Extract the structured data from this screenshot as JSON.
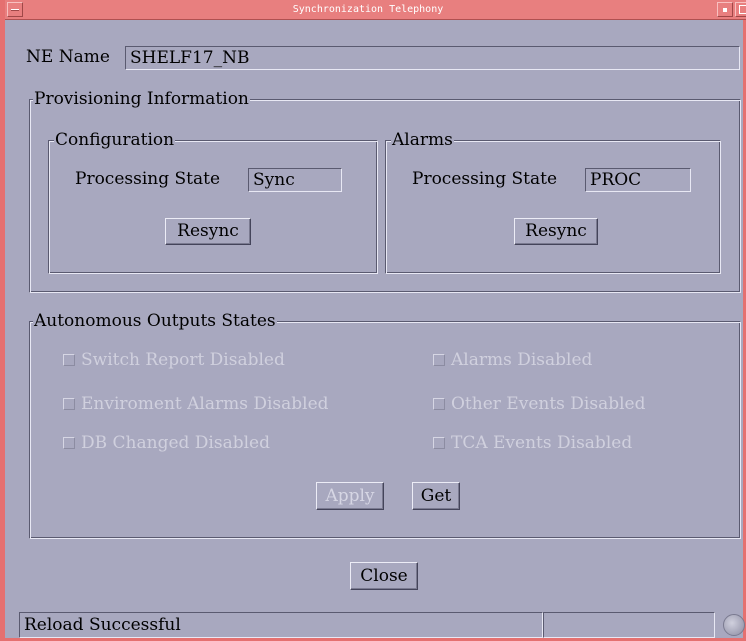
{
  "window": {
    "title": "Synchronization Telephony"
  },
  "ne": {
    "label": "NE Name",
    "value": "SHELF17_NB"
  },
  "provisioning": {
    "title": "Provisioning Information",
    "configuration": {
      "title": "Configuration",
      "state_label": "Processing State",
      "state_value": "Sync",
      "button": "Resync"
    },
    "alarms": {
      "title": "Alarms",
      "state_label": "Processing State",
      "state_value": "PROC",
      "button": "Resync"
    }
  },
  "autonomous": {
    "title": "Autonomous Outputs States",
    "checkboxes": [
      {
        "label": "Switch Report Disabled",
        "checked": false,
        "enabled": false
      },
      {
        "label": "Alarms Disabled",
        "checked": false,
        "enabled": false
      },
      {
        "label": "Enviroment Alarms Disabled",
        "checked": false,
        "enabled": false
      },
      {
        "label": "Other Events Disabled",
        "checked": false,
        "enabled": false
      },
      {
        "label": "DB Changed Disabled",
        "checked": false,
        "enabled": false
      },
      {
        "label": "TCA Events Disabled",
        "checked": false,
        "enabled": false
      }
    ],
    "apply_label": "Apply",
    "get_label": "Get"
  },
  "close_label": "Close",
  "status": {
    "message": "Reload Successful",
    "secondary": ""
  },
  "icons": {
    "window_menu": "window-menu-icon",
    "minimize": "minimize-icon",
    "maximize": "maximize-icon",
    "status_globe": "globe-icon"
  },
  "colors": {
    "background": "#a8a8bf",
    "titlebar": "#e87f7f",
    "disabled_text": "#d0d0de"
  }
}
